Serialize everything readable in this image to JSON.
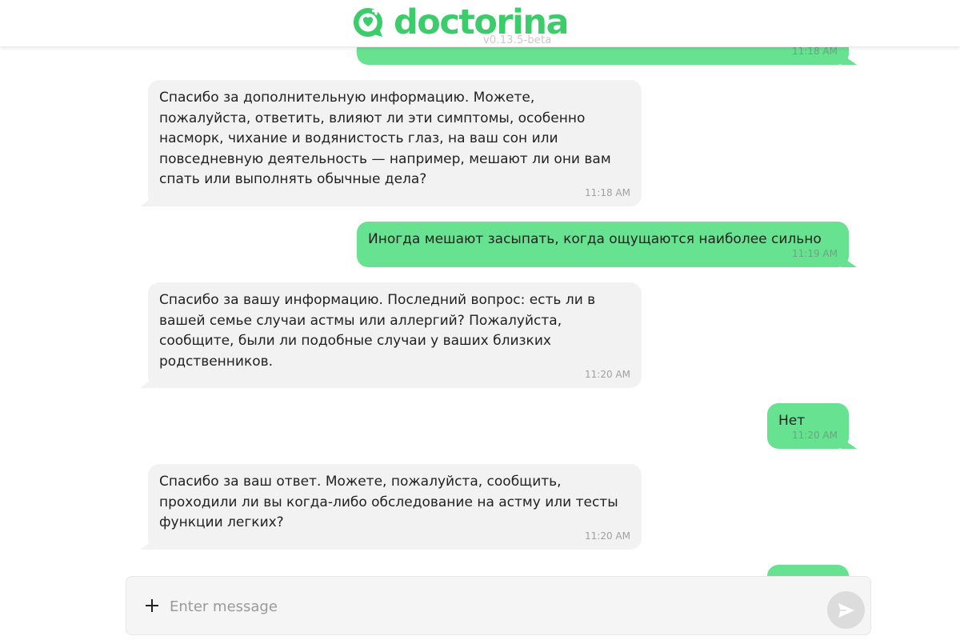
{
  "header": {
    "brand": "doctorina",
    "version": "v0.13.5-beta"
  },
  "colors": {
    "brand_green": "#3dcc6b",
    "user_bubble": "#66e290",
    "bot_bubble": "#f2f2f2"
  },
  "messages": [
    {
      "sender": "user",
      "text": "",
      "time": "11:18 AM"
    },
    {
      "sender": "bot",
      "text": "Спасибо за дополнительную информацию. Можете,\nпожалуйста, ответить, влияют ли эти симптомы, особенно\nнасморк, чихание и водянистость глаз, на ваш сон или\nповседневную деятельность — например, мешают ли они вам\nспать или выполнять обычные дела?",
      "time": "11:18 AM"
    },
    {
      "sender": "user",
      "text": "Иногда мешают засыпать, когда ощущаются наиболее сильно",
      "time": "11:19 AM"
    },
    {
      "sender": "bot",
      "text": "Спасибо за вашу информацию. Последний вопрос: есть ли в\nвашей семье случаи астмы или аллергий? Пожалуйста,\nсообщите, были ли подобные случаи у ваших близких\nродственников.",
      "time": "11:20 AM"
    },
    {
      "sender": "user",
      "text": "Нет",
      "time": "11:20 AM"
    },
    {
      "sender": "bot",
      "text": "Спасибо за ваш ответ. Можете, пожалуйста, сообщить,\nпроходили ли вы когда-либо обследование на астму или тесты\nфункции легких?",
      "time": "11:20 AM"
    },
    {
      "sender": "user",
      "text": "",
      "time": ""
    }
  ],
  "composer": {
    "placeholder": "Enter message",
    "attach_icon": "plus-icon",
    "send_icon": "send-icon"
  }
}
